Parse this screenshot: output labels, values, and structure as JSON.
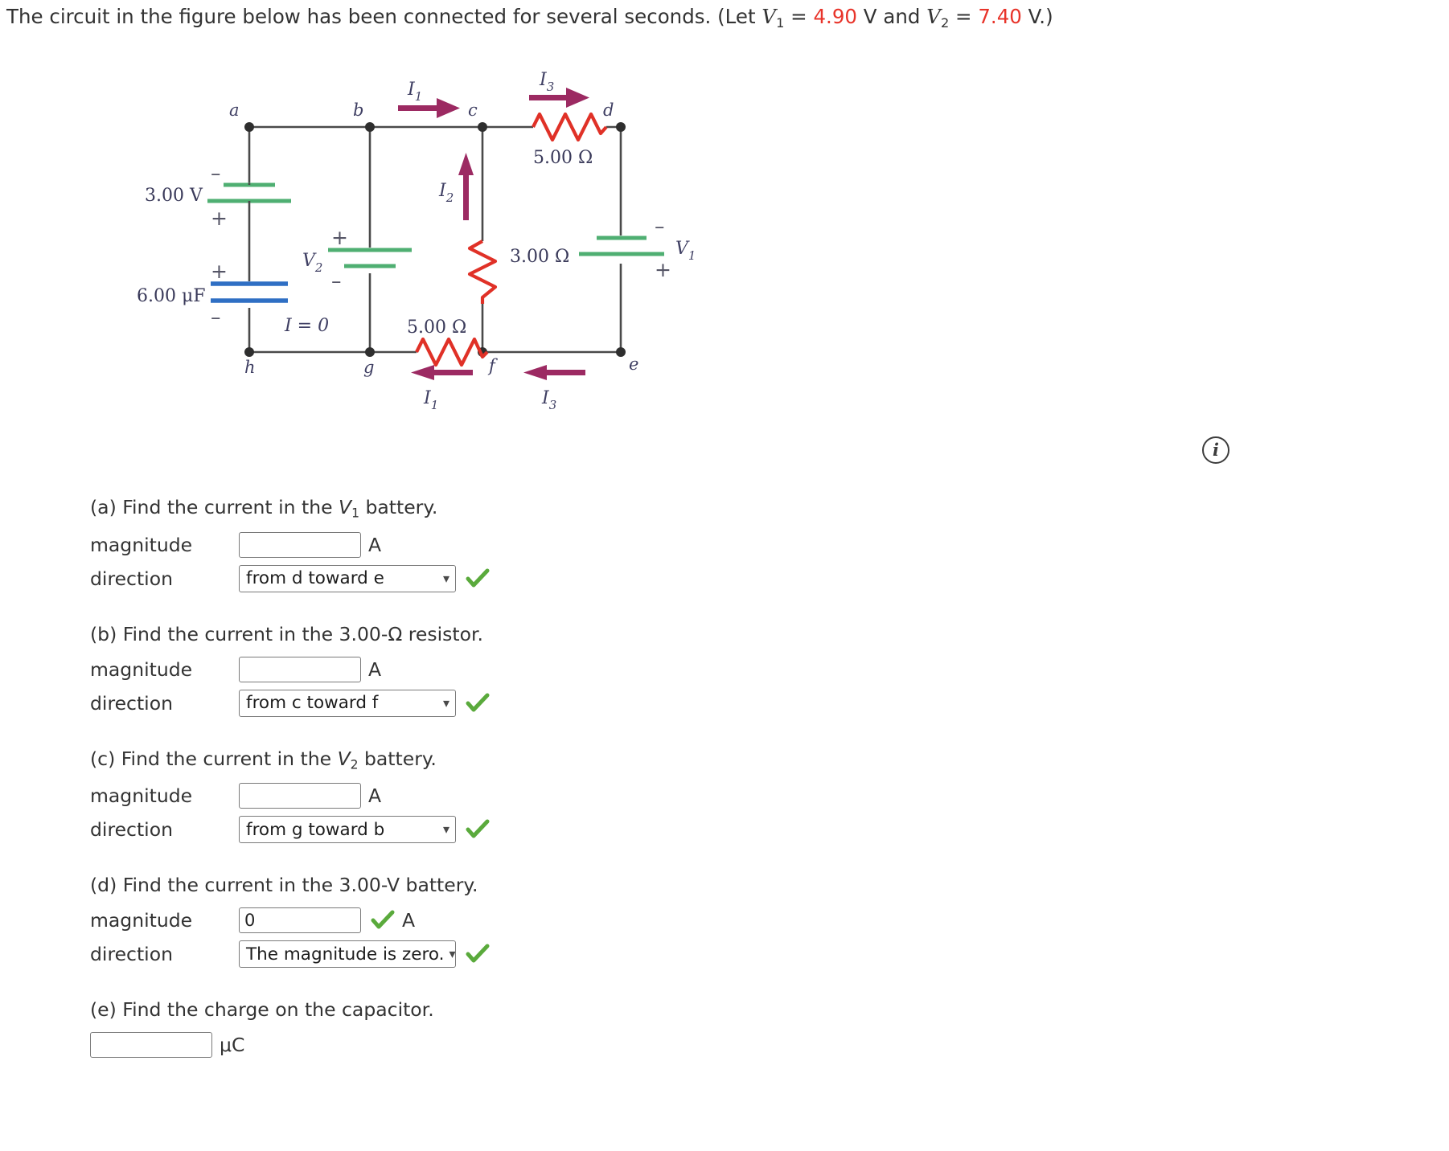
{
  "prompt": {
    "text_before": "The circuit in the figure below has been connected for several seconds. (Let ",
    "v1_symbol": "V",
    "v1_sub": "1",
    "eq1": " = ",
    "v1_value": "4.90",
    "unit1": " V and ",
    "v2_symbol": "V",
    "v2_sub": "2",
    "eq2": " = ",
    "v2_value": "7.40",
    "unit2": " V.)",
    "value_color": "#e8342a"
  },
  "figure": {
    "nodes": {
      "a": "a",
      "b": "b",
      "c": "c",
      "d": "d",
      "e": "e",
      "f": "f",
      "g": "g",
      "h": "h"
    },
    "components": {
      "battery_3v": "3.00 V",
      "capacitor": "6.00 μF",
      "battery_v2": "V",
      "battery_v2_sub": "2",
      "battery_v1": "V",
      "battery_v1_sub": "1",
      "resistor_top": "5.00 Ω",
      "resistor_middle": "3.00 Ω",
      "resistor_bottom": "5.00 Ω"
    },
    "currents": {
      "i1_top": "I",
      "i1_top_sub": "1",
      "i2": "I",
      "i2_sub": "2",
      "i3_top": "I",
      "i3_top_sub": "3",
      "i1_bottom": "I",
      "i1_bottom_sub": "1",
      "i3_bottom": "I",
      "i3_bottom_sub": "3",
      "i_zero": "I = 0"
    },
    "polarity": {
      "battery_3v_top": "–",
      "battery_3v_bottom": "+",
      "capacitor_top": "+",
      "capacitor_bottom": "–",
      "battery_v2_top": "+",
      "battery_v2_bottom": "–",
      "battery_v1_top": "–",
      "battery_v1_bottom": "+"
    },
    "colors": {
      "wire": "#4a4a4a",
      "resistor": "#e03127",
      "battery": "#4faf72",
      "capacitor": "#2f6fc4",
      "current_arrow": "#9c2a62",
      "label": "#3a3a5a"
    }
  },
  "info_icon_label": "i",
  "questions": [
    {
      "id": "a",
      "title_parts": {
        "prefix": "(a) Find the current in the ",
        "var": "V",
        "sub": "1",
        "suffix": " battery."
      },
      "magnitude_label": "magnitude",
      "magnitude_value": "",
      "magnitude_unit": "A",
      "magnitude_checked": false,
      "direction_label": "direction",
      "direction_value": "from d toward e",
      "direction_checked": true
    },
    {
      "id": "b",
      "title_parts": {
        "prefix": "(b) Find the current in the 3.00-Ω resistor.",
        "var": "",
        "sub": "",
        "suffix": ""
      },
      "magnitude_label": "magnitude",
      "magnitude_value": "",
      "magnitude_unit": "A",
      "magnitude_checked": false,
      "direction_label": "direction",
      "direction_value": "from c toward f",
      "direction_checked": true
    },
    {
      "id": "c",
      "title_parts": {
        "prefix": "(c) Find the current in the ",
        "var": "V",
        "sub": "2",
        "suffix": " battery."
      },
      "magnitude_label": "magnitude",
      "magnitude_value": "",
      "magnitude_unit": "A",
      "magnitude_checked": false,
      "direction_label": "direction",
      "direction_value": "from g toward b",
      "direction_checked": true
    },
    {
      "id": "d",
      "title_parts": {
        "prefix": "(d) Find the current in the 3.00-V battery.",
        "var": "",
        "sub": "",
        "suffix": ""
      },
      "magnitude_label": "magnitude",
      "magnitude_value": "0",
      "magnitude_unit": "A",
      "magnitude_checked": true,
      "direction_label": "direction",
      "direction_value": "The magnitude is zero.",
      "direction_checked": true
    }
  ],
  "question_e": {
    "title": "(e) Find the charge on the capacitor.",
    "value": "",
    "unit": "μC"
  }
}
